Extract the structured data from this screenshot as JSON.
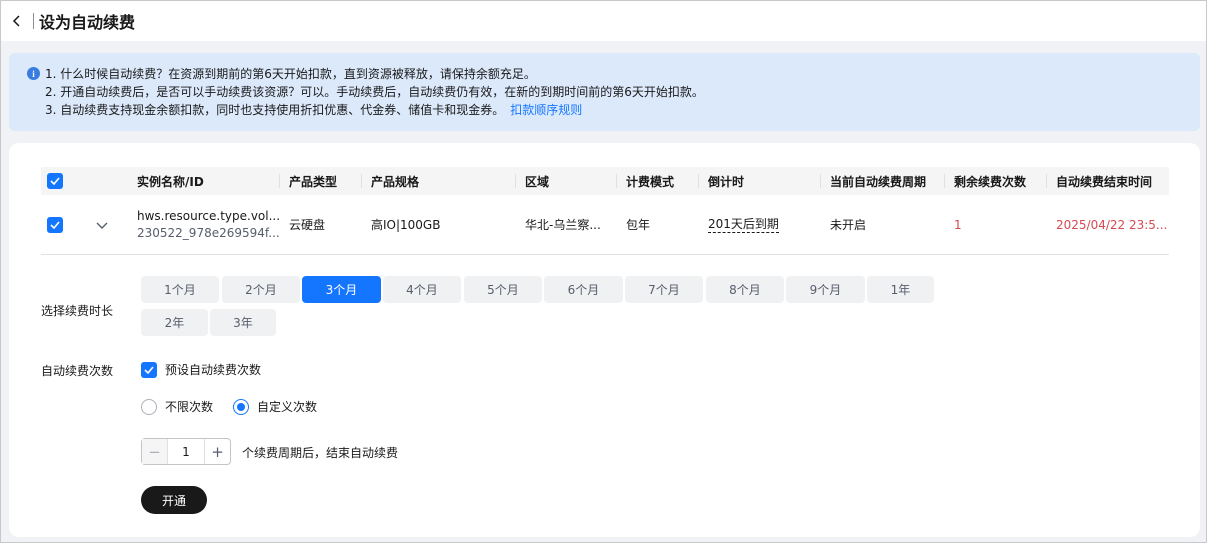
{
  "header": {
    "title": "设为自动续费"
  },
  "notice": {
    "lines": [
      "1. 什么时候自动续费？在资源到期前的第6天开始扣款，直到资源被释放，请保持余额充足。",
      "2. 开通自动续费后，是否可以手动续费该资源？可以。手动续费后，自动续费仍有效，在新的到期时间前的第6天开始扣款。",
      "3. 自动续费支持现金余额扣款，同时也支持使用折扣优惠、代金券、储值卡和现金券。"
    ],
    "link": "扣款顺序规则"
  },
  "table": {
    "columns": [
      "实例名称/ID",
      "产品类型",
      "产品规格",
      "区域",
      "计费模式",
      "倒计时",
      "当前自动续费周期",
      "剩余续费次数",
      "自动续费结束时间"
    ],
    "rows": [
      {
        "name": "hws.resource.type.vol...",
        "id": "230522_978e269594f...",
        "type": "云硬盘",
        "spec": "高IO|100GB",
        "region": "华北-乌兰察...",
        "billing": "包年",
        "countdown": "201天后到期",
        "current_cycle": "未开启",
        "remaining": "1",
        "end_time": "2025/04/22 23:5..."
      }
    ]
  },
  "form": {
    "duration_label": "选择续费时长",
    "durations": [
      "1个月",
      "2个月",
      "3个月",
      "4个月",
      "5个月",
      "6个月",
      "7个月",
      "8个月",
      "9个月",
      "1年",
      "2年",
      "3年"
    ],
    "selected_duration": "3个月",
    "times_label": "自动续费次数",
    "preset_checkbox": "预设自动续费次数",
    "radio_unlimited": "不限次数",
    "radio_custom": "自定义次数",
    "stepper_value": "1",
    "stepper_suffix": "个续费周期后，结束自动续费",
    "submit": "开通"
  },
  "colors": {
    "accent": "#1476ff",
    "danger": "#d64a52",
    "notice_bg": "#dce9fb"
  }
}
